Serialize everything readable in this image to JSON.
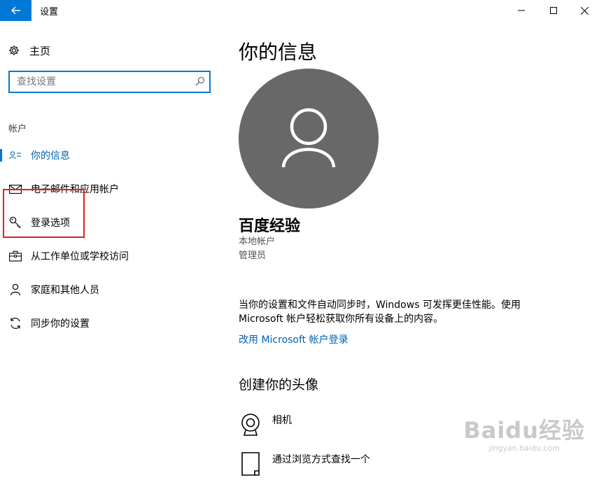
{
  "window": {
    "title": "设置"
  },
  "sidebar": {
    "home_label": "主页",
    "search_placeholder": "查找设置",
    "section_label": "帐户",
    "items": [
      {
        "label": "你的信息",
        "icon": "person-card-icon",
        "active": true
      },
      {
        "label": "电子邮件和应用帐户",
        "icon": "mail-icon"
      },
      {
        "label": "登录选项",
        "icon": "key-icon"
      },
      {
        "label": "从工作单位或学校访问",
        "icon": "briefcase-icon"
      },
      {
        "label": "家庭和其他人员",
        "icon": "person-icon"
      },
      {
        "label": "同步你的设置",
        "icon": "sync-icon"
      }
    ]
  },
  "main": {
    "page_title": "你的信息",
    "user": {
      "name": "百度经验",
      "account_type": "本地帐户",
      "role": "管理员"
    },
    "sync_text": "当你的设置和文件自动同步时，Windows 可发挥更佳性能。使用 Microsoft 帐户轻松获取你所有设备上的内容。",
    "switch_link": "改用 Microsoft 帐户登录",
    "avatar_heading": "创建你的头像",
    "options": [
      {
        "label": "相机",
        "icon": "webcam-icon"
      },
      {
        "label": "通过浏览方式查找一个",
        "icon": "browse-file-icon"
      }
    ]
  },
  "watermark": {
    "brand": "Baidu经验",
    "url": "jingyan.baidu.com"
  },
  "colors": {
    "accent": "#0078d7",
    "link": "#0063b1",
    "avatar_bg": "#686868",
    "highlight": "#e02020"
  }
}
